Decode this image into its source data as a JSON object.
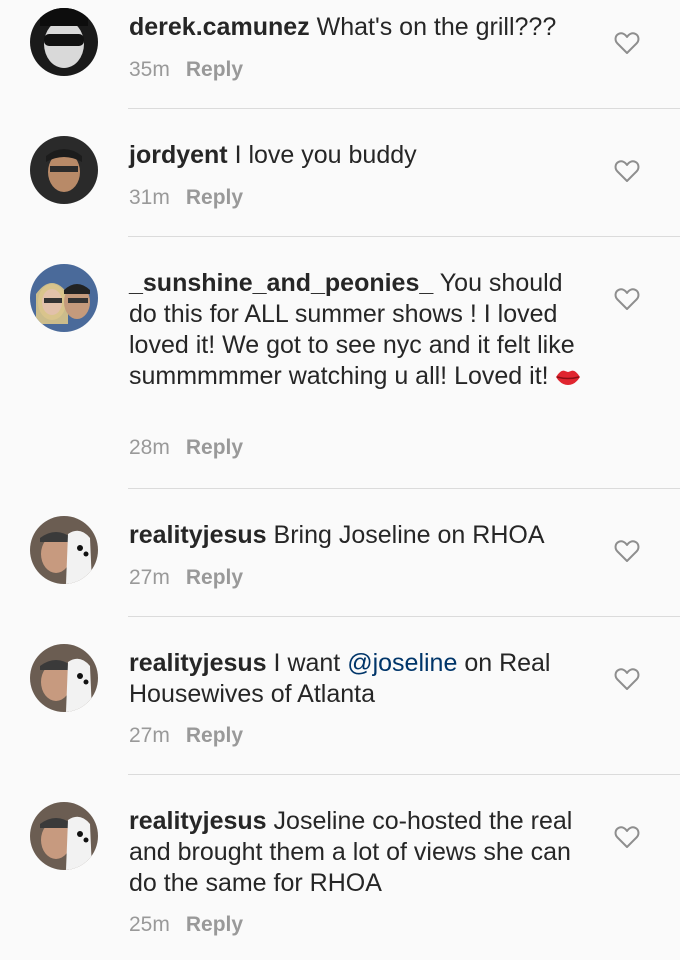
{
  "comments": [
    {
      "username": "derek.camunez",
      "text": "What's on the grill???",
      "time": "35m",
      "reply": "Reply"
    },
    {
      "username": "jordyent",
      "text": "I love you buddy",
      "time": "31m",
      "reply": "Reply"
    },
    {
      "username": "_sunshine_and_peonies_",
      "text": "You should do this for ALL summer shows ! I loved loved it! We got to see nyc and it felt like summmmmer watching u all! Loved it!",
      "emoji": "kiss-lips",
      "time": "28m",
      "reply": "Reply"
    },
    {
      "username": "realityjesus",
      "text": "Bring Joseline on RHOA",
      "time": "27m",
      "reply": "Reply"
    },
    {
      "username": "realityjesus",
      "text_before": "I want",
      "mention": "@joseline",
      "text_after": "on Real Housewives of Atlanta",
      "time": "27m",
      "reply": "Reply"
    },
    {
      "username": "realityjesus",
      "text": "Joseline co-hosted the real and brought them a lot of views she can do the same for RHOA",
      "time": "25m",
      "reply": "Reply"
    }
  ],
  "icons": {
    "like": "heart-outline-icon",
    "reaction": "kiss-lips-icon"
  },
  "colors": {
    "username": "#262626",
    "meta": "#999999",
    "mention": "#003569",
    "divider": "#dbdbdb"
  }
}
